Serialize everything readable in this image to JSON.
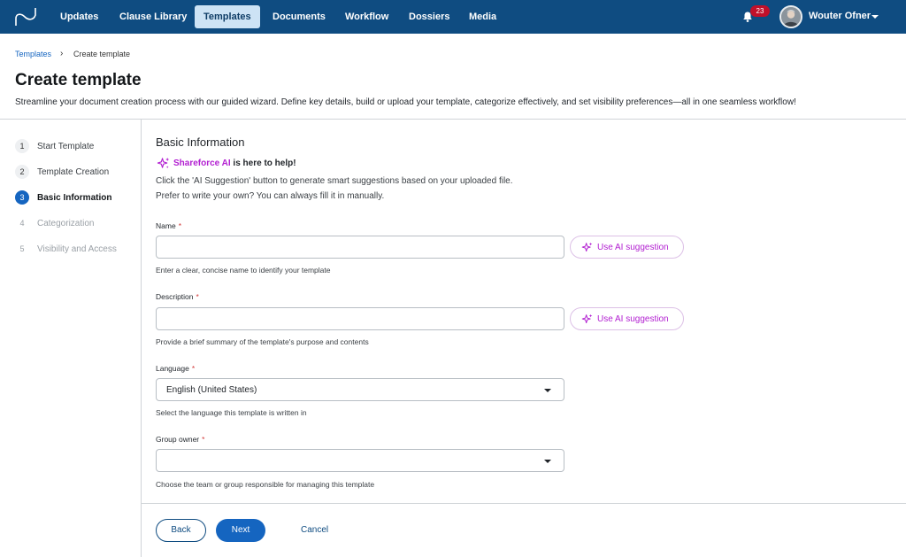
{
  "nav": {
    "items": [
      {
        "label": "Updates",
        "active": false
      },
      {
        "label": "Clause Library",
        "active": false
      },
      {
        "label": "Templates",
        "active": true
      },
      {
        "label": "Documents",
        "active": false
      },
      {
        "label": "Workflow",
        "active": false
      },
      {
        "label": "Dossiers",
        "active": false
      },
      {
        "label": "Media",
        "active": false
      }
    ],
    "notification_count": "23",
    "user_name": "Wouter Ofner",
    "icons": {
      "logo": "app-logo-icon",
      "notifications": "bell-icon",
      "user_menu": "caret-down-icon"
    }
  },
  "breadcrumb": {
    "root": "Templates",
    "separator": "›",
    "current": "Create template"
  },
  "header": {
    "title": "Create template",
    "description": "Streamline your document creation process with our guided wizard. Define key details, build or upload your template, categorize effectively, and set visibility preferences—all in one seamless workflow!"
  },
  "steps": [
    {
      "num": "1",
      "label": "Start Template",
      "state": "done"
    },
    {
      "num": "2",
      "label": "Template Creation",
      "state": "done"
    },
    {
      "num": "3",
      "label": "Basic Information",
      "state": "active"
    },
    {
      "num": "4",
      "label": "Categorization",
      "state": "disabled"
    },
    {
      "num": "5",
      "label": "Visibility and Access",
      "state": "disabled"
    }
  ],
  "form": {
    "section_title": "Basic Information",
    "ai_brand": "Shareforce AI",
    "ai_tagline": " is here to help!",
    "ai_line1": "Click the 'AI Suggestion' button to generate smart suggestions based on your uploaded file.",
    "ai_line2": "Prefer to write your own? You can always fill it in manually.",
    "required_marker": "*",
    "ai_button_label": "Use AI suggestion",
    "name": {
      "label": "Name",
      "value": "",
      "hint": "Enter a clear, concise name to identify your template"
    },
    "description": {
      "label": "Description",
      "value": "",
      "hint": "Provide a brief summary of the template's purpose and contents"
    },
    "language": {
      "label": "Language",
      "value": "English (United States)",
      "hint": "Select the language this template is written in"
    },
    "group_owner": {
      "label": "Group owner",
      "value": "",
      "hint": "Choose the team or group responsible for managing this template"
    }
  },
  "footer": {
    "back": "Back",
    "next": "Next",
    "cancel": "Cancel"
  },
  "colors": {
    "nav_bg": "#0f4c81",
    "nav_active_bg": "#cde3f5",
    "primary": "#1565c0",
    "ai_purple": "#b21fd1",
    "badge": "#c0102a"
  }
}
